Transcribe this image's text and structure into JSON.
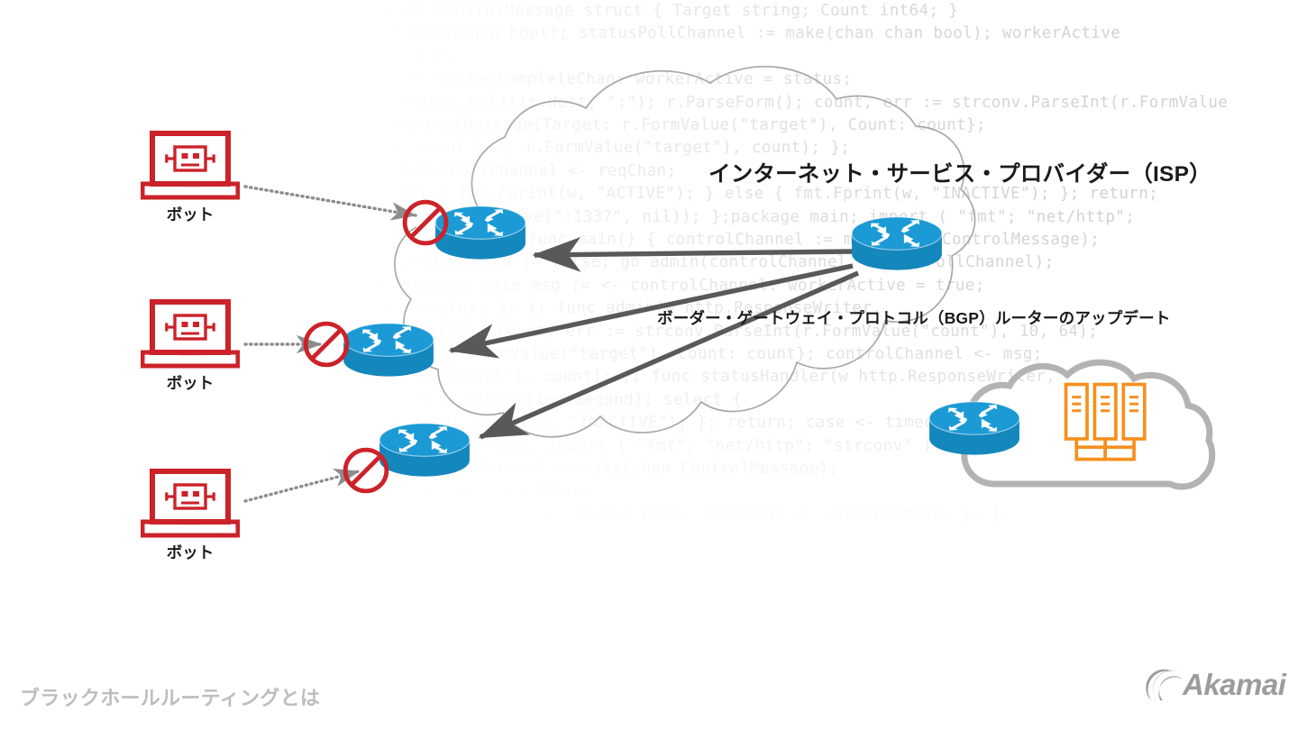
{
  "title": "ブラックホールルーティングとは",
  "diagram": {
    "isp_cloud_label": "インターネット・サービス・プロバイダー（ISP）",
    "bgp_update_label": "ボーダー・ゲートウェイ・プロトコル（BGP）ルーターのアップデート",
    "bots": [
      {
        "label": "ボット"
      },
      {
        "label": "ボット"
      },
      {
        "label": "ボット"
      }
    ],
    "blocked_sign_name": "blocked",
    "routers": [
      {
        "name": "edge-router-1"
      },
      {
        "name": "edge-router-2"
      },
      {
        "name": "edge-router-3"
      },
      {
        "name": "core-router"
      },
      {
        "name": "datacenter-router"
      }
    ],
    "datacenter": {
      "servers": 3
    }
  },
  "brand": {
    "logo_text": "Akamai"
  },
  "colors": {
    "router_blue": "#1b9ad6",
    "router_blue_dark": "#1487bd",
    "bot_red": "#cc2229",
    "block_red": "#cc2229",
    "arrow_gray": "#595959",
    "cloud_gray_thin": "#a8a8a8",
    "cloud_gray_thick": "#b3b3b3",
    "server_orange": "#f5901f",
    "code_gray": "#d2d2d2",
    "caption_gray": "#bdbdbd",
    "logo_gray": "#9c9c9c"
  },
  "background_code": {
    "lines": [
      "package main; import ( \"fmt\"; \"net/http\"; \"strconv\"; \"time\" ); type ControlMessage struct { Target string; Count int64; }",
      "func main() { controlChannel := make(chan ControlMessage); workerCompleteChan := make(chan bool); statusPollChannel := make(chan chan bool); workerActive",
      "case respChan := <- statusPollChannel: respChan <- workerActive; case msg := <-",
      "controlChannel: workerActive = true; go doStuff(msg, workerCompleteChan); case status := <- workerCompleteChan: workerActive = status;",
      "func admin(w http.ResponseWriter, r *http.Request) { hostTokens := strings.Split(r.Host, \":\"); r.ParseForm(); count, err := strconv.ParseInt(r.FormValue",
      "(\"count\"), 10, 64); if err != nil { fmt.Fprintf(w, err.Error()); return; }; msg := ControlMessage{Target: r.FormValue(\"target\"), Count: count};",
      "controlChannel <- msg; fmt.Fprintf(w, \"Control message issued for Target %s, count %d\", r.FormValue(\"target\"), count); };",
      "func statusHandler(w http.ResponseWriter, r *http.Request) { reqChan := make(chan bool); statusPollChannel <- reqChan;",
      "timeout := time.After(time.Second); select { case result := <- reqChan: if result { fmt.Fprint(w, \"ACTIVE\"); } else { fmt.Fprint(w, \"INACTIVE\"); }; return;",
      "case <- timeout: fmt.Fprint(w, \"TIMEOUT\"); }; }; log.Fatal(http.ListenAndServe(\":1337\", nil)); };package main; import ( \"fmt\"; \"net/http\";",
      "\"strconv\"; \"time\" ); type ControlMessage struct { Target string; Count int64; }; func main() { controlChannel := make(chan ControlMessage);",
      "workerCompleteChan := make(chan bool); statusPollChannel := make(chan chan bool); workerActive := false; go admin(controlChannel, statusPollChannel);",
      "for { select { case respChan := <- statusPollChannel: respChan <- workerActive; case msg := <- controlChannel: workerActive = true;",
      "go doStuff(msg, workerCompleteChan); case status := <- workerCompleteChan: workerActive = status; }; }; func admin(w http.ResponseWriter,",
      "r *http.Request) { hostTokens := strings.Split(r.Host, \":\"); r.ParseForm(); count, err := strconv.ParseInt(r.FormValue(\"count\"), 10, 64);",
      "if err != nil { fmt.Fprintf(w, err.Error()); return; }; msg := ControlMessage{Target: r.FormValue(\"target\"), Count: count}; controlChannel <- msg;",
      "fmt.Fprintf(w, \"Control message issued for Target %s, count %d\", r.FormValue(\"target\"), count); }; func statusHandler(w http.ResponseWriter,",
      "r *http.Request) { reqChan := make(chan bool); statusPollChannel <- reqChan; timeout := time.After(time.Second); select {",
      "case result := <- reqChan: if result { fmt.Fprint(w, \"ACTIVE\"); } else { fmt.Fprint(w, \"INACTIVE\"); }; return; case <- timeout:",
      "fmt.Fprint(w, \"TIMEOUT\"); }; }; log.Fatal(http.ListenAndServe(\":1337\", nil)); };package main; import ( \"fmt\"; \"net/http\"; \"strconv\" );",
      "type ControlMessage struct { Target string; Count int64; }; func main() { controlChannel := make(chan ControlMessage);",
      "workerCompleteChan := make(chan bool); statusPollChannel := make(chan chan bool); workerActive := false;",
      "go admin(controlChannel, statusPollChannel); for { select { case respChan := <- statusPollChannel: respChan <- workerActive; }; };"
    ]
  }
}
